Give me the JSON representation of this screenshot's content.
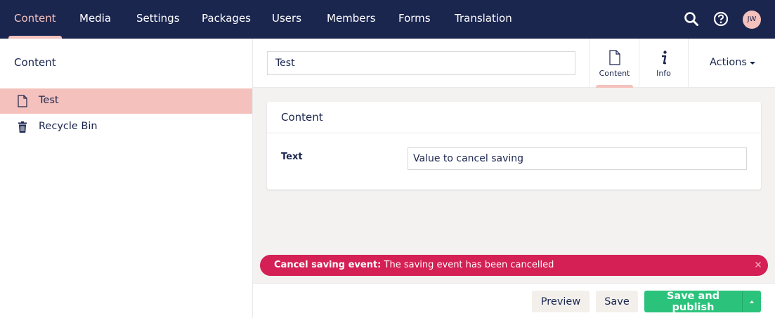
{
  "topbar": {
    "nav": [
      {
        "label": "Content",
        "active": true
      },
      {
        "label": "Media"
      },
      {
        "label": "Settings"
      },
      {
        "label": "Packages"
      },
      {
        "label": "Users"
      },
      {
        "label": "Members"
      },
      {
        "label": "Forms"
      },
      {
        "label": "Translation"
      }
    ],
    "icons": [
      "search-icon",
      "help-icon"
    ],
    "avatar_initials": "JW"
  },
  "tree": {
    "title": "Content",
    "items": [
      {
        "label": "Test",
        "icon": "document-icon",
        "selected": true
      },
      {
        "label": "Recycle Bin",
        "icon": "trash-icon"
      }
    ]
  },
  "editor": {
    "name_value": "Test",
    "apps": [
      {
        "label": "Content",
        "icon": "document-icon",
        "active": true
      },
      {
        "label": "Info",
        "icon": "info-icon"
      }
    ],
    "actions_label": "Actions",
    "group_title": "Content",
    "property": {
      "label": "Text",
      "value": "Value to cancel saving"
    }
  },
  "notification": {
    "headline": "Cancel saving event:",
    "message": " The saving event has been cancelled"
  },
  "footer": {
    "preview_label": "Preview",
    "save_label": "Save",
    "publish_label": "Save and publish"
  },
  "colors": {
    "nav_bg": "#1b264f",
    "accent": "#f5c1bc",
    "danger": "#d42054",
    "success": "#2bc37c"
  }
}
